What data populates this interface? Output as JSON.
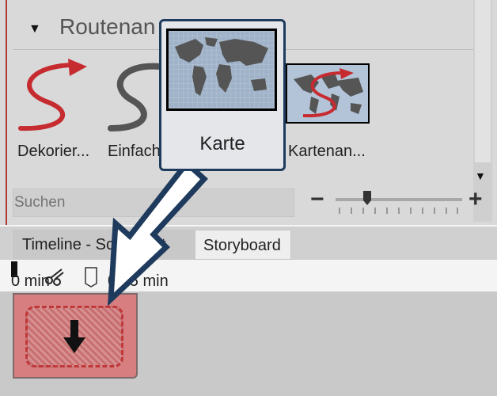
{
  "section": {
    "title": "Routenan"
  },
  "items": [
    {
      "label": "Dekorier..."
    },
    {
      "label": "Einfach"
    },
    {
      "label": "Kartenan..."
    }
  ],
  "popup": {
    "label": "Karte"
  },
  "search": {
    "placeholder": "Suchen"
  },
  "zoom": {
    "minus": "−",
    "plus": "+",
    "level": 0.22
  },
  "tabs": [
    {
      "label": "Timeline - Sch.....cht"
    },
    {
      "label": "Storyboard"
    }
  ],
  "ruler": {
    "start": "0 min",
    "end": "0,05 min"
  },
  "colors": {
    "accent_red": "#c0383a",
    "popup_border": "#1e3a5c",
    "arrow_outline": "#1e3a5c"
  }
}
